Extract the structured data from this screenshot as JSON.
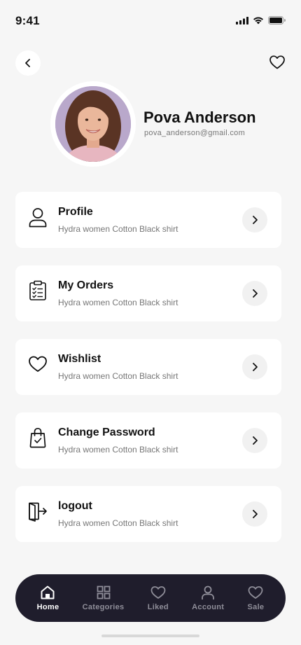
{
  "status_bar": {
    "time": "9:41"
  },
  "profile": {
    "name": "Pova Anderson",
    "email": "pova_anderson@gmail.com"
  },
  "menu": [
    {
      "title": "Profile",
      "subtitle": "Hydra women Cotton Black shirt",
      "icon": "user-icon"
    },
    {
      "title": "My Orders",
      "subtitle": "Hydra women Cotton Black shirt",
      "icon": "clipboard-icon"
    },
    {
      "title": "Wishlist",
      "subtitle": "Hydra women Cotton Black shirt",
      "icon": "heart-icon"
    },
    {
      "title": "Change Password",
      "subtitle": "Hydra women Cotton Black shirt",
      "icon": "shopping-bag-icon"
    },
    {
      "title": "logout",
      "subtitle": "Hydra women Cotton Black shirt",
      "icon": "logout-icon"
    }
  ],
  "bottom_nav": [
    {
      "label": "Home",
      "icon": "home-icon",
      "active": true
    },
    {
      "label": "Categories",
      "icon": "grid-icon",
      "active": false
    },
    {
      "label": "Liked",
      "icon": "heart-icon",
      "active": false
    },
    {
      "label": "Account",
      "icon": "user-icon",
      "active": false
    },
    {
      "label": "Sale",
      "icon": "heart-icon",
      "active": false
    }
  ],
  "colors": {
    "background": "#f6f6f6",
    "card": "#ffffff",
    "nav_bg": "#1f1d2c",
    "nav_active": "#ffffff",
    "nav_inactive": "#8f8e99"
  }
}
